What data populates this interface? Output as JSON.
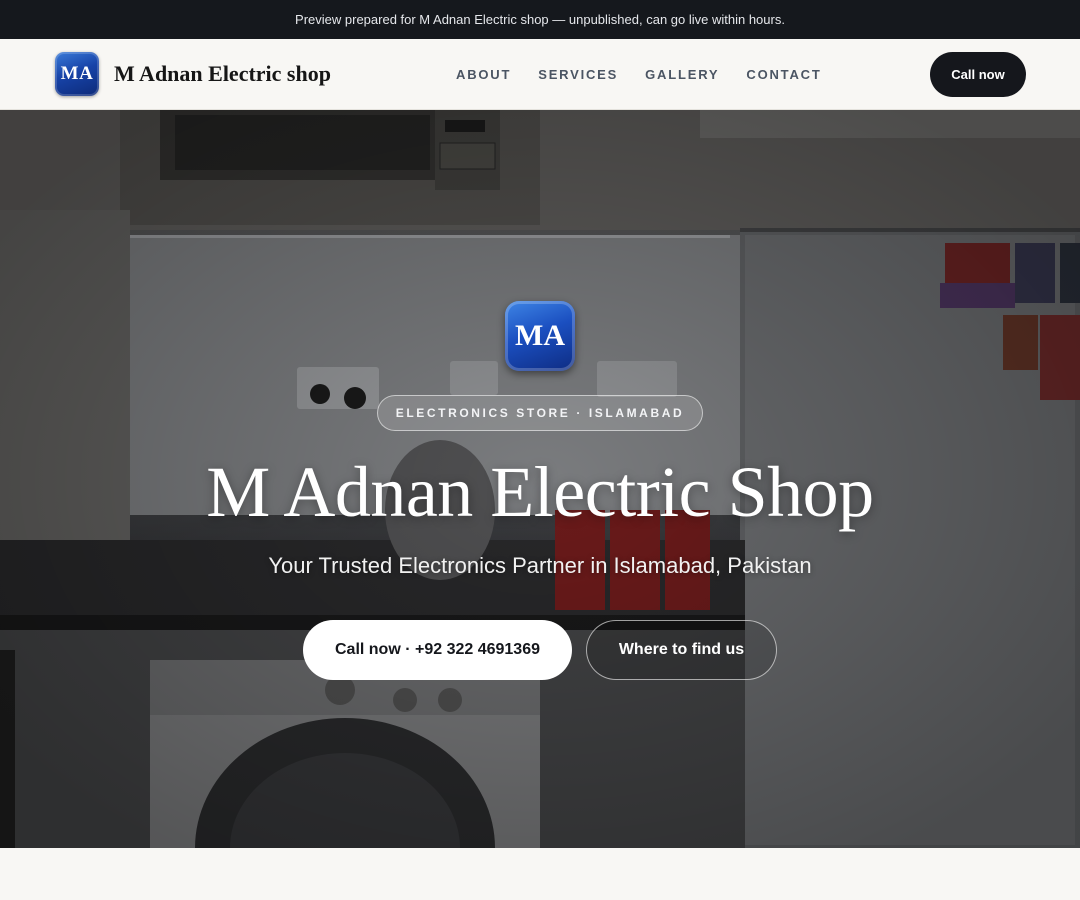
{
  "preview_banner": {
    "text": "Preview prepared for M Adnan Electric shop — unpublished, can go live within hours."
  },
  "header": {
    "logo_text": "MA",
    "brand_name": "M Adnan Electric shop",
    "nav": [
      {
        "label": "ABOUT"
      },
      {
        "label": "SERVICES"
      },
      {
        "label": "GALLERY"
      },
      {
        "label": "CONTACT"
      }
    ],
    "cta_label": "Call now"
  },
  "hero": {
    "logo_text": "MA",
    "badge": "ELECTRONICS STORE · ISLAMABAD",
    "title": "M Adnan Electric Shop",
    "subtitle": "Your Trusted Electronics Partner in Islamabad, Pakistan",
    "primary_cta": "Call now · +92 322 4691369",
    "secondary_cta": "Where to find us",
    "background_image": "kitchen-appliances-photo"
  },
  "colors": {
    "dark": "#15171c",
    "logo_blue": "#1b4fc0",
    "page_bg": "#f8f7f4",
    "nav_text": "#4b5563"
  }
}
